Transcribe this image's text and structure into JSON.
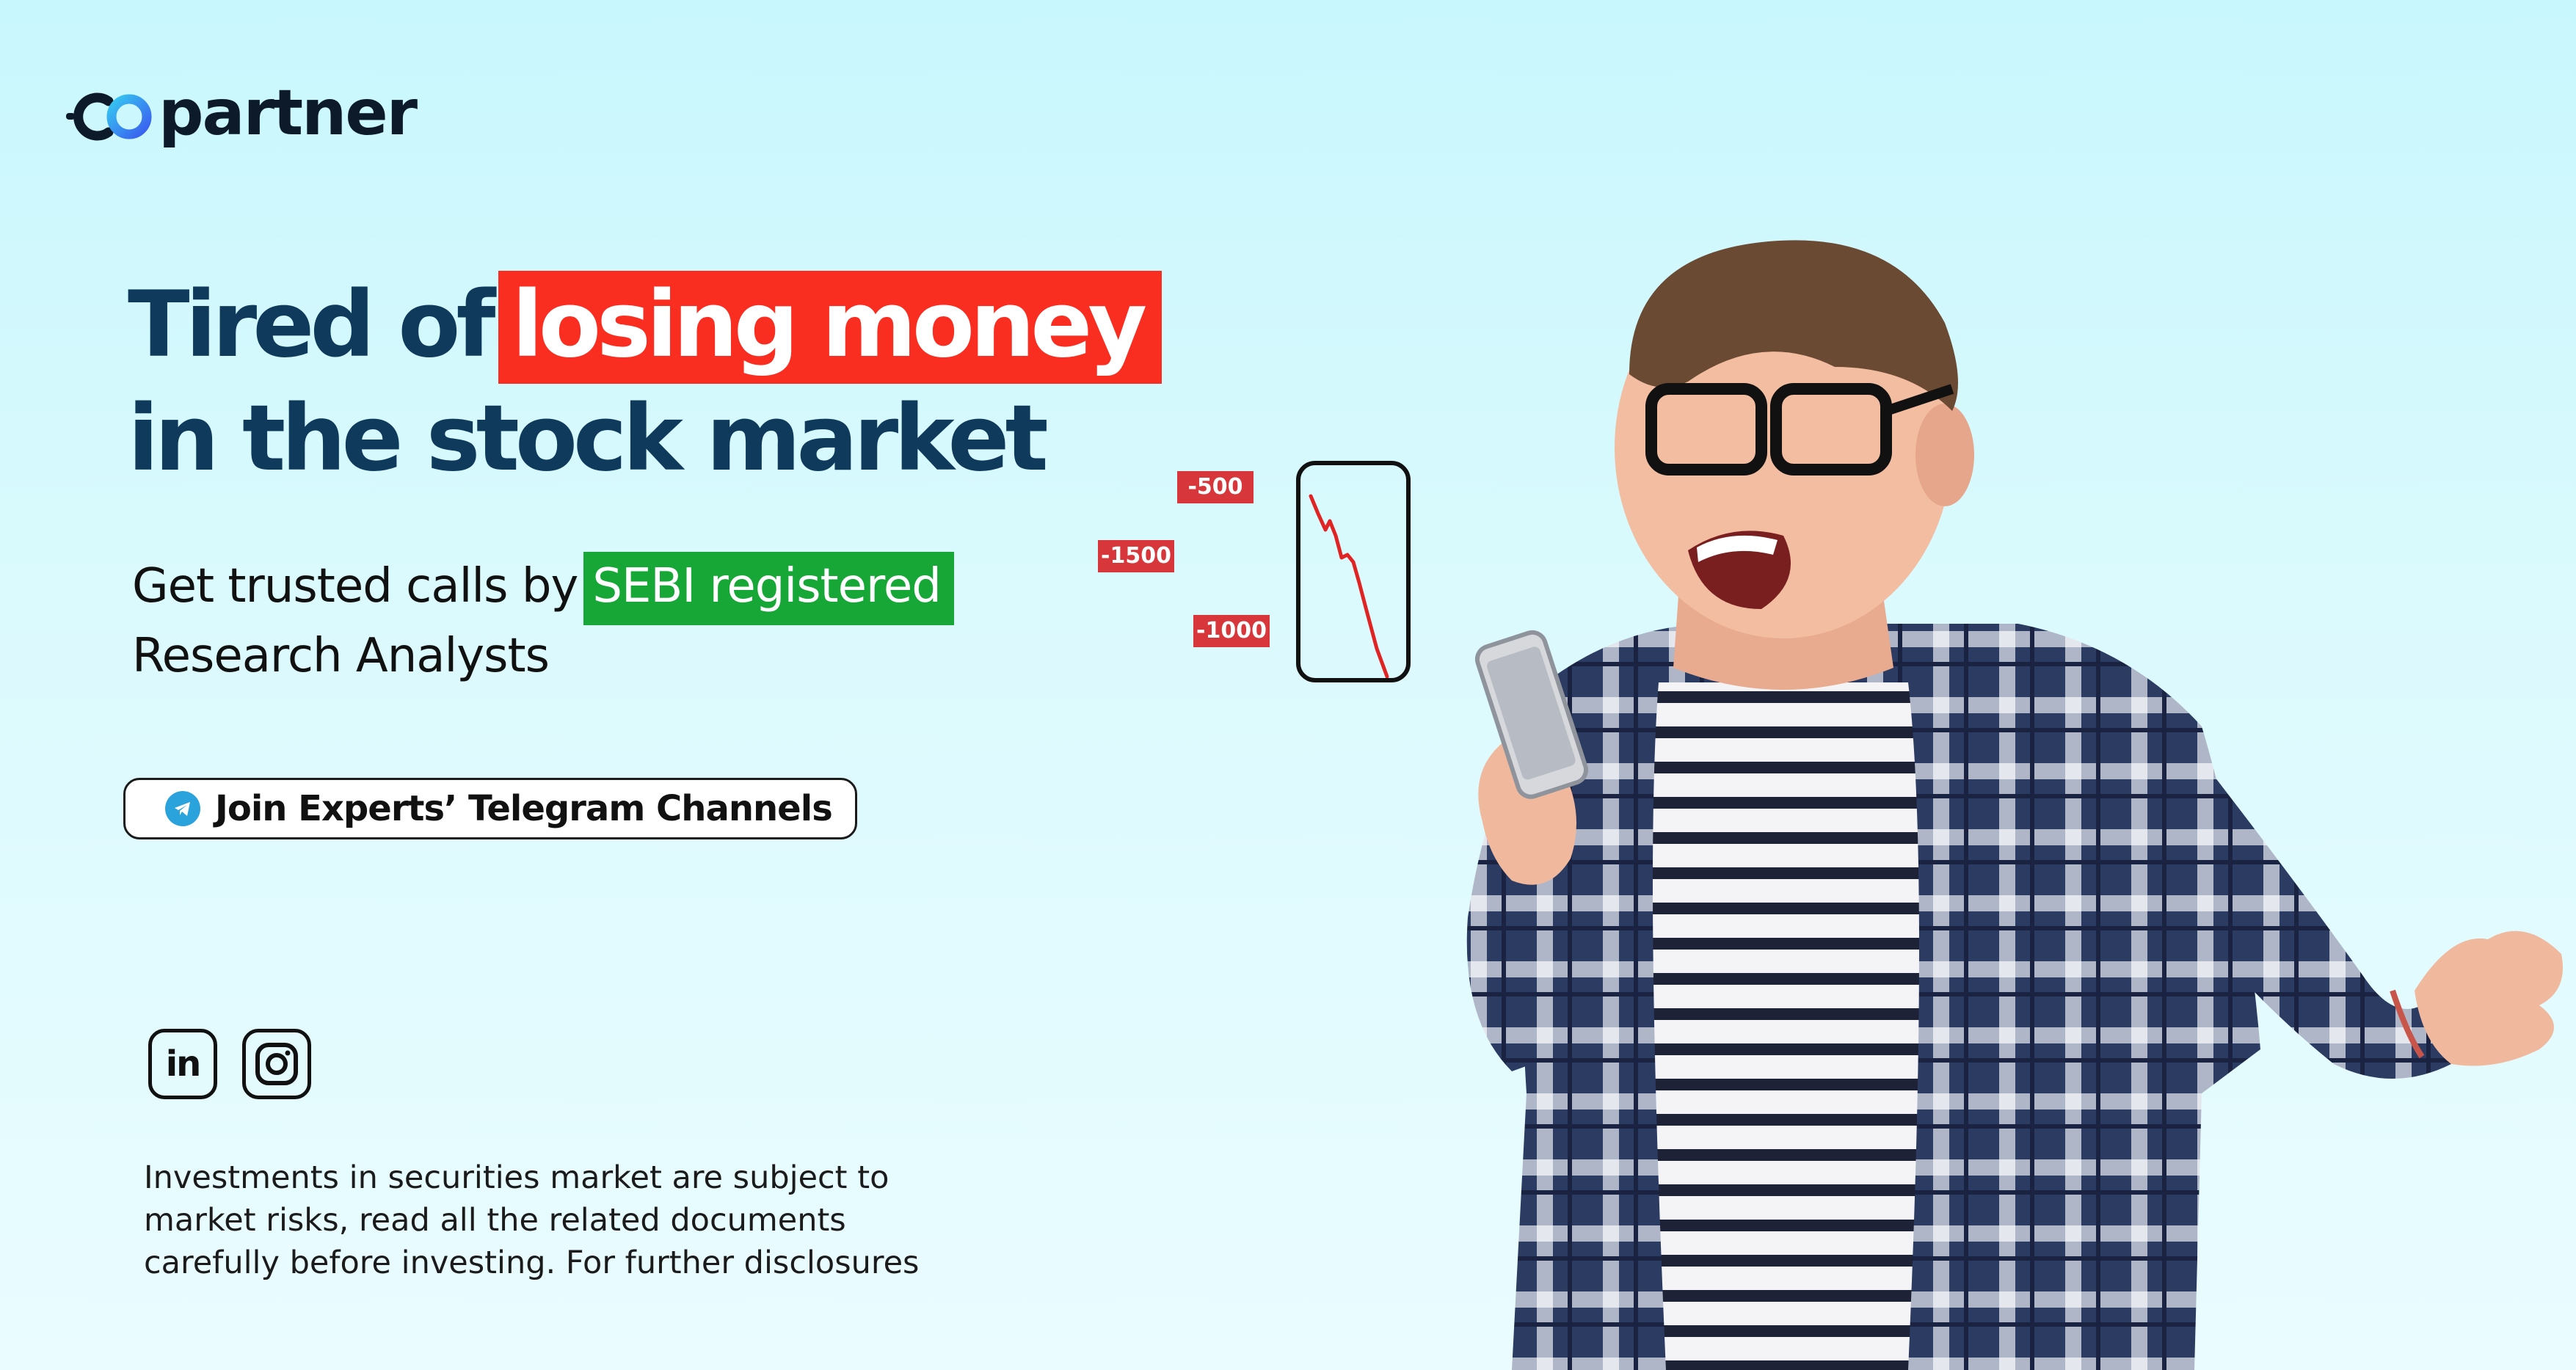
{
  "brand": {
    "logo_text": "partner"
  },
  "headline": {
    "prefix": "Tired of",
    "highlight": "losing money",
    "line2": "in the stock market",
    "highlight_color": "#fa2d21",
    "text_color": "#0f3a5c"
  },
  "subheadline": {
    "prefix": "Get trusted calls by",
    "highlight": "SEBI registered",
    "line2": "Research Analysts",
    "highlight_color": "#17a737"
  },
  "cta": {
    "icon": "telegram-icon",
    "label": "Join Experts’ Telegram Channels"
  },
  "social": [
    {
      "name": "linkedin",
      "icon": "linkedin-icon",
      "text": "in"
    },
    {
      "name": "instagram",
      "icon": "instagram-icon"
    }
  ],
  "disclaimer": {
    "lines": [
      "Investments in securities market are subject to",
      "market risks, read all the related documents",
      "carefully before investing. For further disclosures"
    ]
  },
  "loss_tags": [
    "-500",
    "-1500",
    "-1000"
  ],
  "colors": {
    "background": "#d4f8fd",
    "loss_red": "#d7363a",
    "telegram_blue": "#2aa3dd",
    "shirt_navy": "#2c3b62"
  }
}
